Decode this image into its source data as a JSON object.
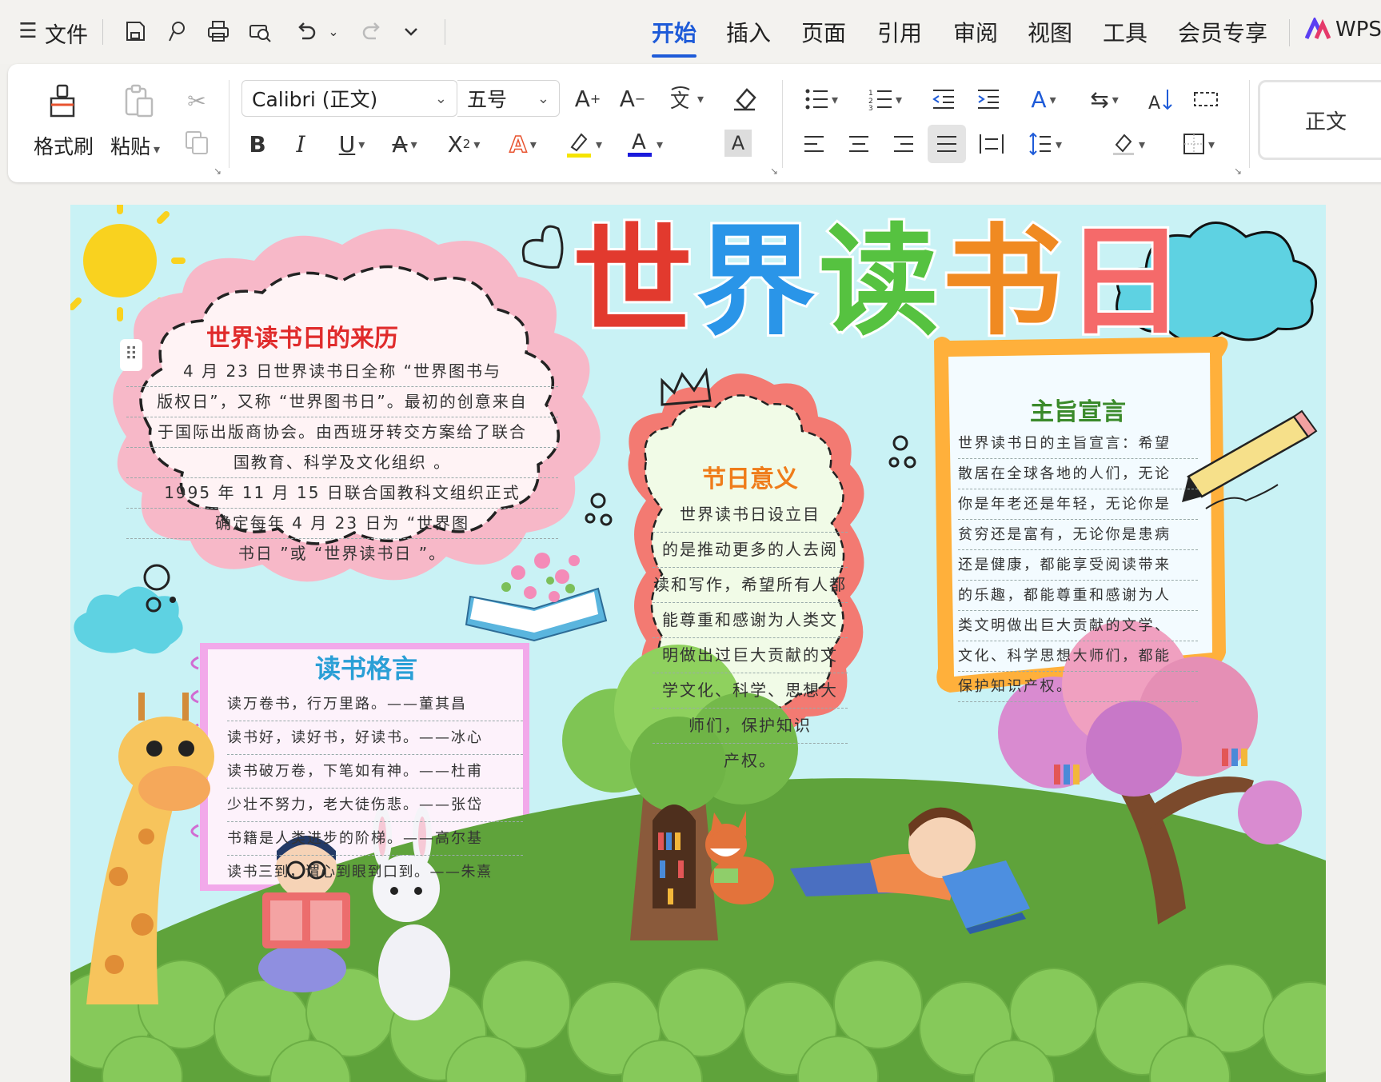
{
  "menu": {
    "file_label": "文件"
  },
  "tabs": [
    "开始",
    "插入",
    "页面",
    "引用",
    "审阅",
    "视图",
    "工具",
    "会员专享"
  ],
  "brand": "WPS",
  "ribbon": {
    "format_painter": "格式刷",
    "paste": "粘贴",
    "font_name": "Calibri (正文)",
    "font_size": "五号",
    "style_name": "正文"
  },
  "poster": {
    "title_chars": [
      "世",
      "界",
      "读",
      "书",
      "日"
    ],
    "history": {
      "heading": "世界读书日的来历",
      "lines": [
        "4 月 23 日世界读书日全称 “世界图书与",
        "版权日”，又称 “世界图书日”。最初的创意来自",
        "于国际出版商协会。由西班牙转交方案给了联合",
        "国教育、科学及文化组织 。",
        "1995 年 11 月 15 日联合国教科文组织正式",
        "确定每年 4 月 23 日为 “世界图",
        "书日 ”或 “世界读书日 ”。"
      ]
    },
    "meaning": {
      "heading": "节日意义",
      "lines": [
        "世界读书日设立目",
        "的是推动更多的人去阅",
        "读和写作，希望所有人都",
        "能尊重和感谢为人类文",
        "明做出过巨大贡献的文",
        "学文化、科学、思想大",
        "师们，保护知识",
        "产权。"
      ]
    },
    "declaration": {
      "heading": "主旨宣言",
      "lines": [
        "世界读书日的主旨宣言：希望",
        "散居在全球各地的人们，无论",
        "你是年老还是年轻，无论你是",
        "贫穷还是富有，无论你是患病",
        "还是健康，都能享受阅读带来",
        "的乐趣，都能尊重和感谢为人",
        "类文明做出巨大贡献的文学、",
        "文化、科学思想大师们，都能",
        "保护知识产权。"
      ]
    },
    "quotes": {
      "heading": "读书格言",
      "lines": [
        "读万卷书，行万里路。——董其昌",
        "读书好，读好书，好读书。——冰心",
        "读书破万卷，下笔如有神。——杜甫",
        "少壮不努力，老大徒伤悲。——张岱",
        "书籍是人类进步的阶梯。——高尔基",
        "读书三到，谓心到眼到口到。——朱熹"
      ]
    }
  }
}
